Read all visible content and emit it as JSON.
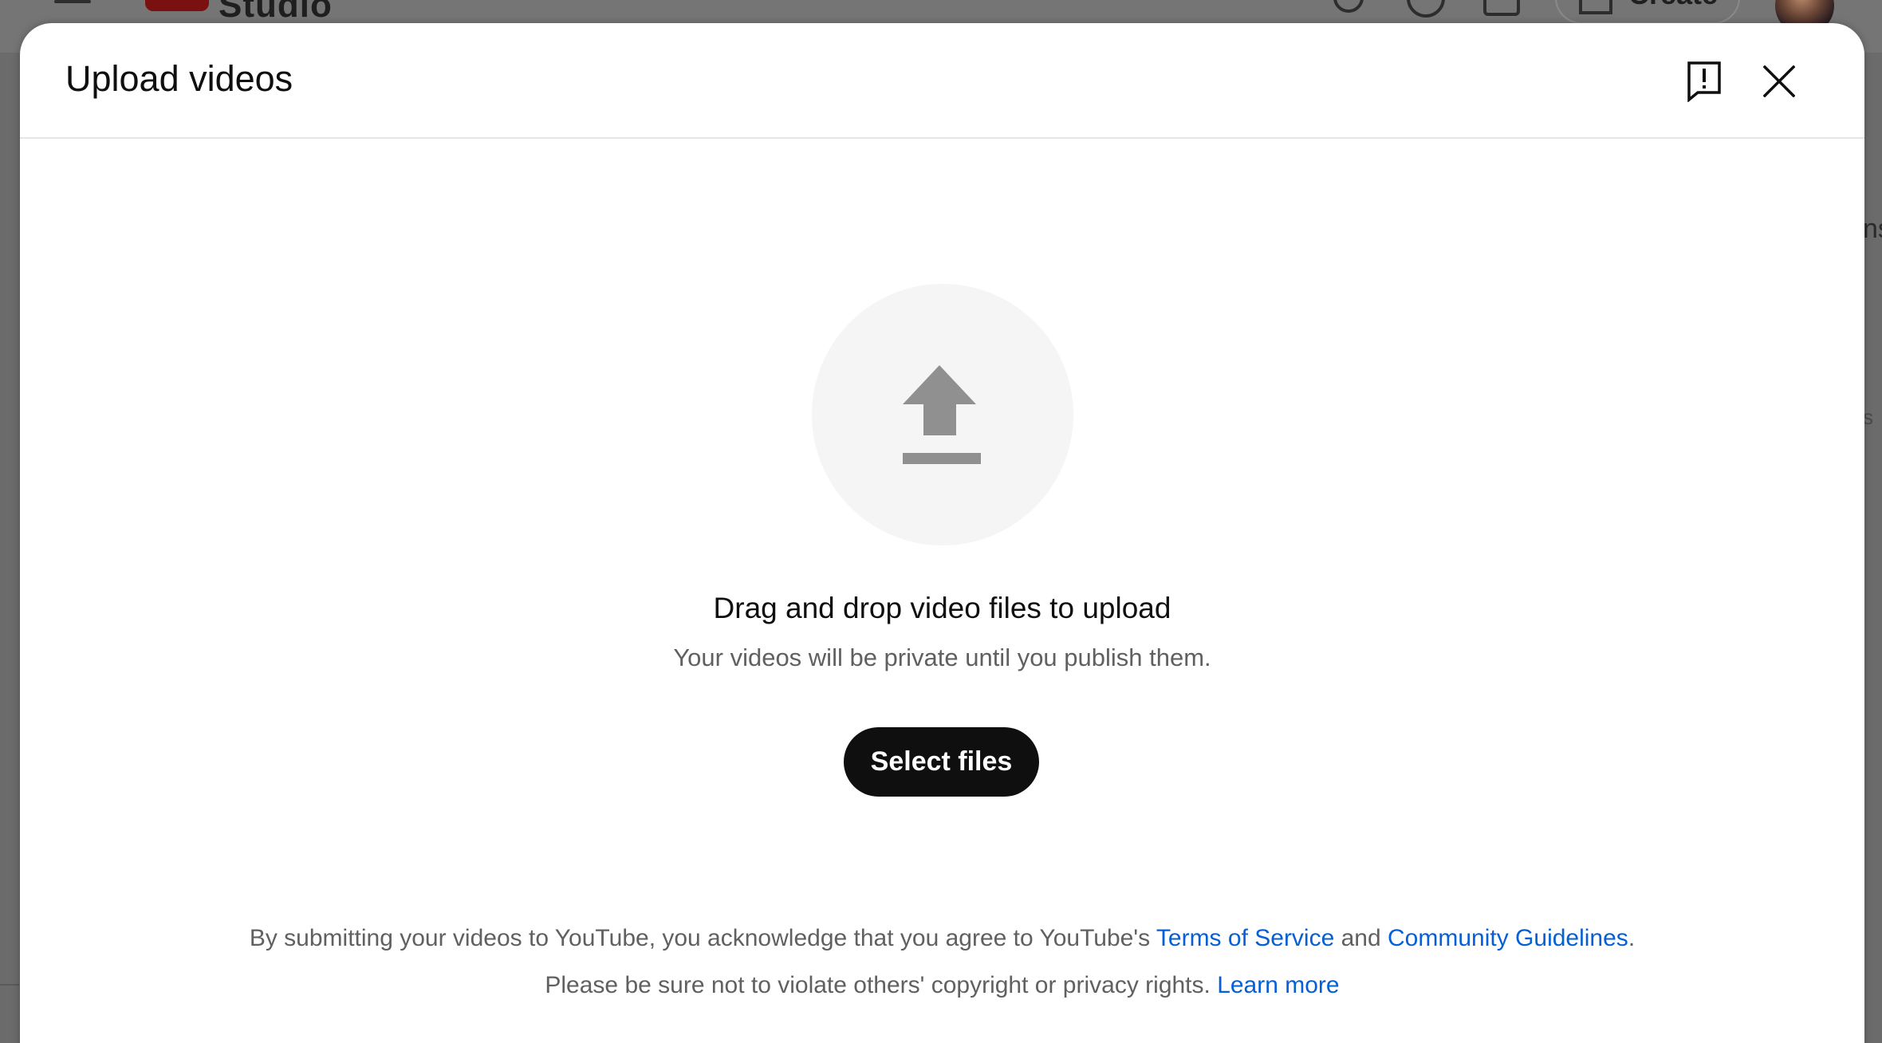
{
  "background_app": {
    "logo_text": "Studio",
    "create_label": "Create",
    "side_text_1": "ns",
    "side_text_2": "s"
  },
  "dialog": {
    "title": "Upload videos",
    "drag_text": "Drag and drop video files to upload",
    "private_text": "Your videos will be private until you publish them.",
    "select_button_label": "Select files",
    "legal_line1_prefix": "By submitting your videos to YouTube, you acknowledge that you agree to YouTube's ",
    "terms_link": "Terms of Service",
    "legal_line1_and": " and ",
    "guidelines_link": "Community Guidelines",
    "legal_line1_end": ".",
    "legal_line2_prefix": "Please be sure not to violate others' copyright or privacy rights. ",
    "learn_more_link": "Learn more"
  },
  "icons": {
    "feedback": "feedback-icon",
    "close": "close-icon",
    "upload": "upload-arrow-icon"
  },
  "colors": {
    "link": "#065fd4",
    "button_bg": "#0f0f0f",
    "muted_text": "#606060",
    "upload_circle": "#f5f5f5"
  }
}
